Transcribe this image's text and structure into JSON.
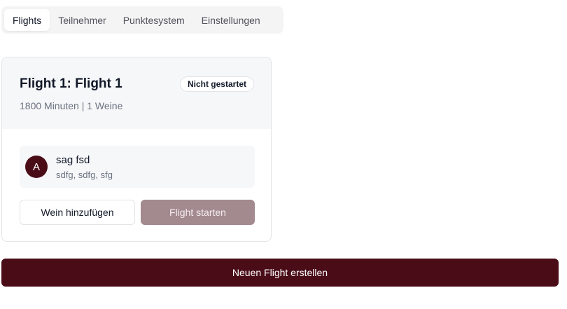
{
  "tabs": [
    {
      "label": "Flights",
      "active": true
    },
    {
      "label": "Teilnehmer",
      "active": false
    },
    {
      "label": "Punktesystem",
      "active": false
    },
    {
      "label": "Einstellungen",
      "active": false
    }
  ],
  "flight": {
    "title": "Flight 1: Flight 1",
    "subtitle": "1800 Minuten | 1 Weine",
    "status": "Nicht gestartet",
    "wines": [
      {
        "avatar": "A",
        "name": "sag fsd",
        "meta": "sdfg, sdfg, sfg"
      }
    ],
    "add_wine_label": "Wein hinzufügen",
    "start_label": "Flight starten"
  },
  "create_label": "Neuen Flight erstellen",
  "colors": {
    "brand": "#4a0d18",
    "brand_disabled": "#a38a8e"
  }
}
